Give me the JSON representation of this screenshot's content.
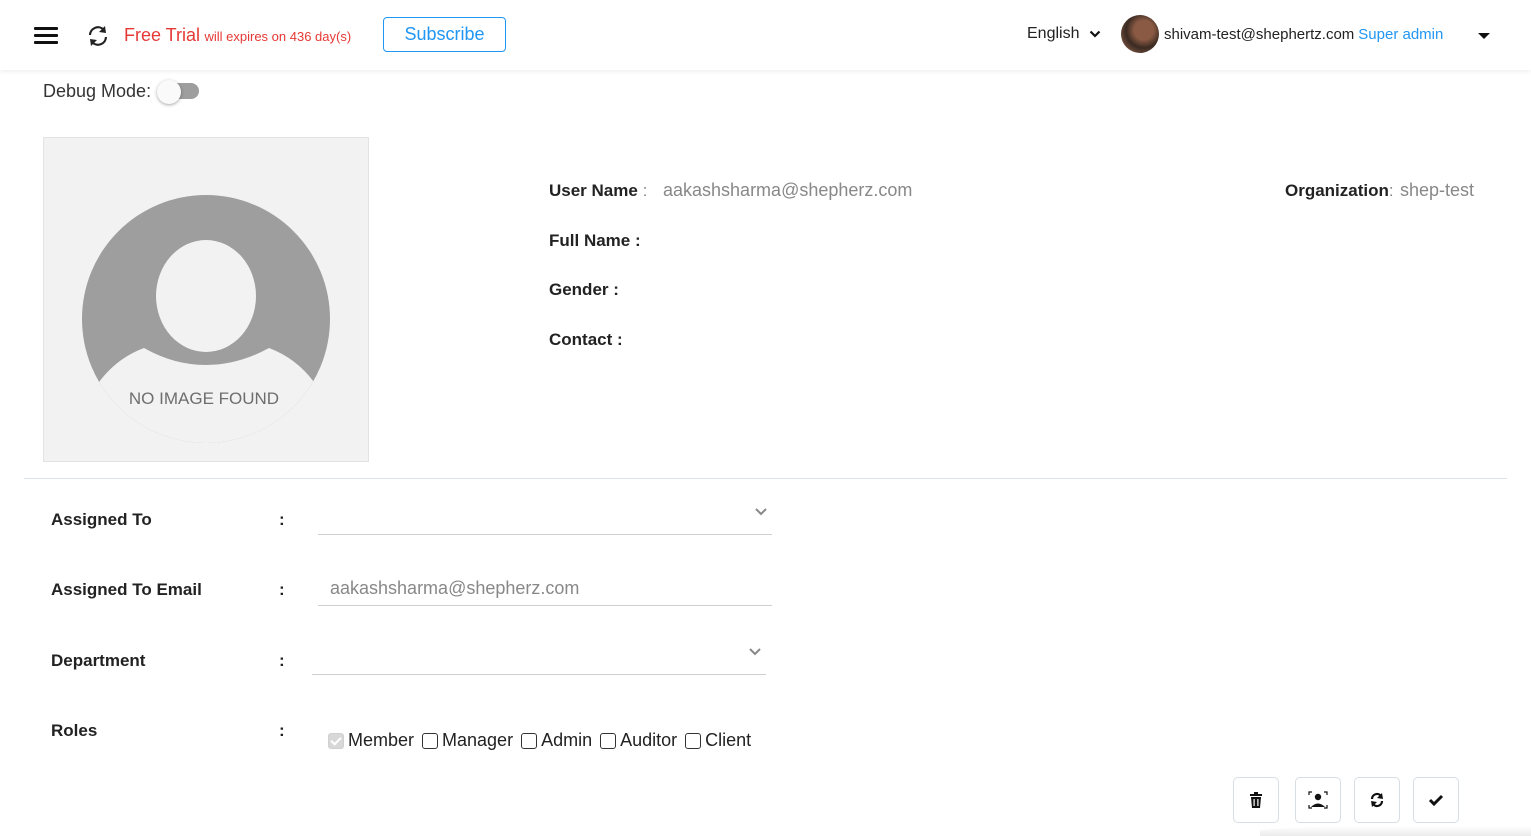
{
  "header": {
    "trial_title": "Free Trial",
    "trial_detail": "will expires on 436 day(s)",
    "subscribe_label": "Subscribe",
    "language": "English",
    "user_email": "shivam-test@shephertz.com",
    "user_role": "Super admin",
    "icons": {
      "menu": "hamburger-menu-icon",
      "sync": "sync-icon",
      "language_caret": "chevron-down-icon",
      "user_caret": "caret-down-icon"
    }
  },
  "debug": {
    "label": "Debug Mode:",
    "enabled": false
  },
  "profile": {
    "placeholder_text": "NO IMAGE FOUND",
    "user_name_label": "User Name",
    "user_name_value": "aakashsharma@shepherz.com",
    "full_name_label": "Full Name :",
    "full_name_value": "",
    "gender_label": "Gender :",
    "gender_value": "",
    "contact_label": "Contact :",
    "contact_value": "",
    "organization_label": "Organization",
    "organization_value": "shep-test"
  },
  "form": {
    "colon": ":",
    "assigned_to": {
      "label": "Assigned To",
      "value": ""
    },
    "assigned_to_email": {
      "label": "Assigned To Email",
      "value": "aakashsharma@shepherz.com"
    },
    "department": {
      "label": "Department",
      "value": ""
    },
    "roles": {
      "label": "Roles",
      "options": [
        {
          "label": "Member",
          "checked": true,
          "disabled": true
        },
        {
          "label": "Manager",
          "checked": false,
          "disabled": false
        },
        {
          "label": "Admin",
          "checked": false,
          "disabled": false
        },
        {
          "label": "Auditor",
          "checked": false,
          "disabled": false
        },
        {
          "label": "Client",
          "checked": false,
          "disabled": false
        }
      ]
    }
  },
  "actions": [
    {
      "name": "delete",
      "icon": "trash-icon"
    },
    {
      "name": "face-scan",
      "icon": "face-scan-icon"
    },
    {
      "name": "refresh",
      "icon": "refresh-icon"
    },
    {
      "name": "save",
      "icon": "check-icon"
    }
  ],
  "colors": {
    "accent": "#2196f3",
    "trial_red": "#e53935",
    "placeholder_gray": "#9e9e9e"
  }
}
